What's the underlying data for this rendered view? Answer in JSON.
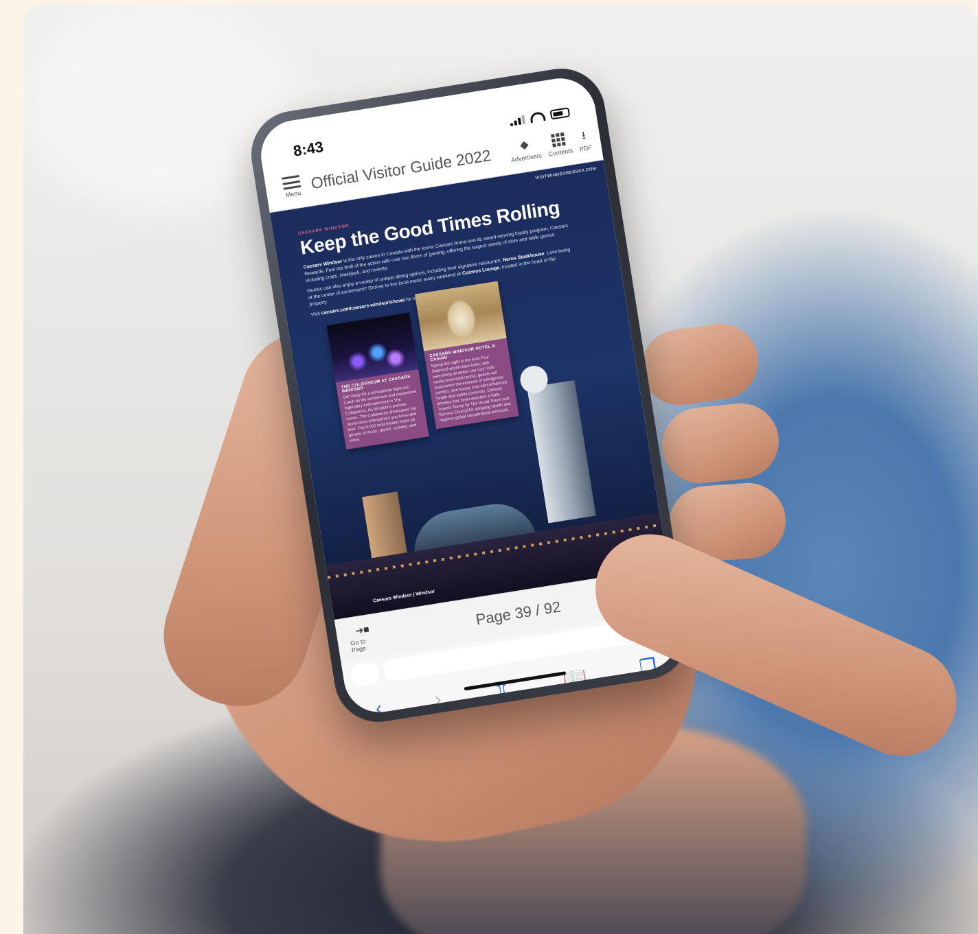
{
  "status": {
    "time": "8:43"
  },
  "app": {
    "title": "Official Visitor Guide 2022",
    "menu_label": "Menu",
    "tools": [
      {
        "label": "Advertisers",
        "icon": "tag-icon"
      },
      {
        "label": "Contents",
        "icon": "grid-icon"
      },
      {
        "label": "PDF",
        "icon": "download-icon"
      }
    ]
  },
  "page": {
    "url": "VISITWINDSORESSEX.COM",
    "kicker": "CAESARS WINDSOR",
    "headline": "Keep the Good Times Rolling",
    "paragraph1_lead": "Caesars Windsor",
    "paragraph1": " is the only casino in Canada with the iconic Caesars brand and its award-winning loyalty program, Caesars Rewards. Feel the thrill of the action with over two floors of gaming, offering the largest variety of slots and table games including craps, blackjack, and roulette.",
    "paragraph2_a": "Guests can also enjoy a variety of unique dining options, including their signature restaurant, ",
    "paragraph2_b": "Neros Steakhouse",
    "paragraph2_c": ". Love being at the center of excitement? Groove to live local music every weekend at ",
    "paragraph2_d": "Cosmos Lounge",
    "paragraph2_e": ", located in the heart of the property.",
    "paragraph3_a": "Visit ",
    "paragraph3_link": "caesars.com/caesars-windsor/shows",
    "paragraph3_b": " for all the latest upcoming shows.",
    "card1": {
      "title": "THE COLOSSEUM AT CAESARS WINDSOR",
      "text": "Get ready for a sensational night out! Catch all the excitement and experience legendary entertainment in The Colosseum. As Windsor's premier venue, The Colosseum showcases the world-class entertainers you know and love. The 5,000 seat theatre hosts all genres of music, dance, comedy, and more."
    },
    "card2": {
      "title": "CAESARS WINDSOR HOTEL & CASINO",
      "text": "Spend the night in the AAA Four Diamond world-class hotel, with everything all under one roof. With newly renovated rooms, guests will experience the essence of indulgence, comfort, and luxury, now with enhanced health and safety protocols. Caesars Windsor has been awarded a Safe Travels Stamp by The World Travel and Tourism Council for adopting health and hygiene global standardized protocols."
    },
    "caption": "Caesars Windsor | Windsor"
  },
  "pager": {
    "goto_label": "Go to Page",
    "indicator": "Page 39 / 92"
  },
  "browser": {
    "back": "‹",
    "forward": "›",
    "share": "⇧",
    "bookmarks": "📖",
    "tabs": "❐"
  }
}
